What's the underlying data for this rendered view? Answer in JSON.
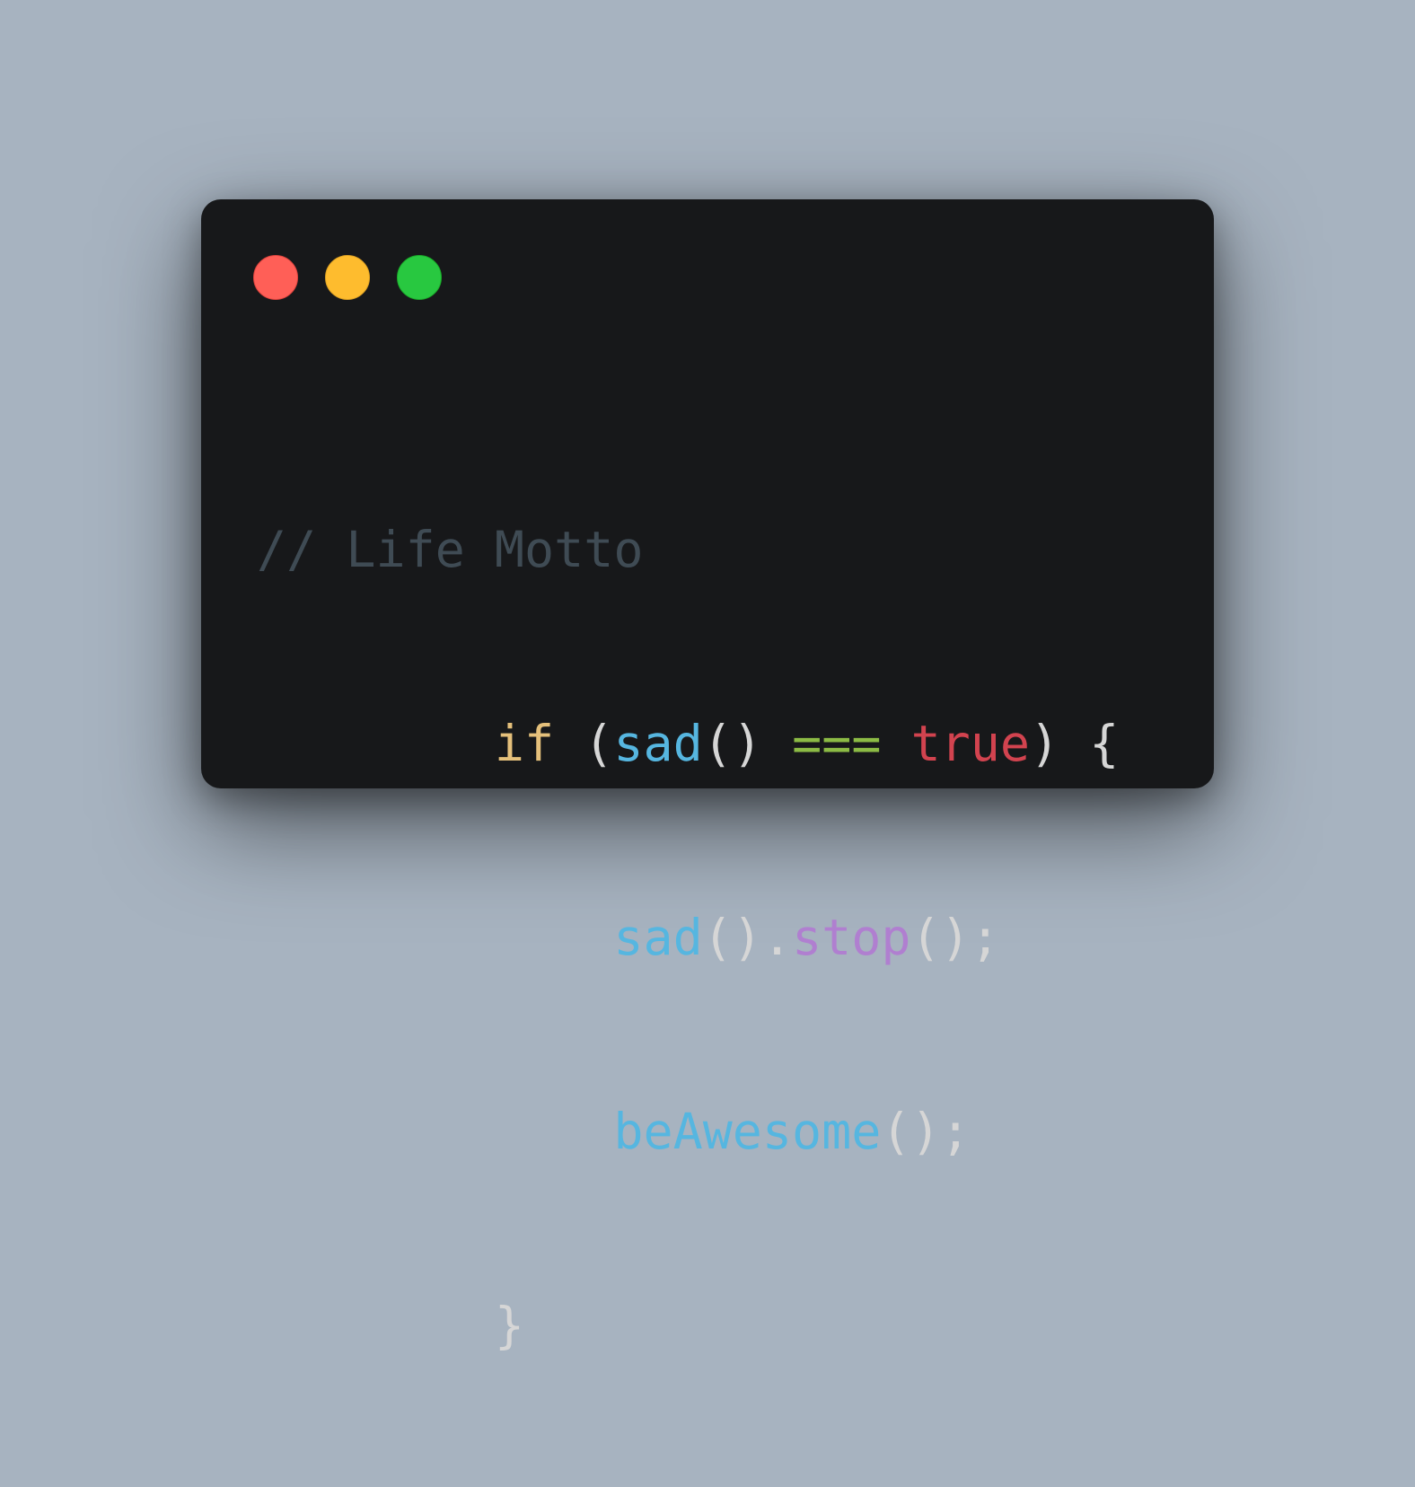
{
  "window_controls": {
    "close_color": "#ff5f57",
    "minimize_color": "#febc2e",
    "maximize_color": "#28c840"
  },
  "code": {
    "comment": "// Life Motto",
    "line1": {
      "indent": "        ",
      "keyword": "if",
      "space": " ",
      "open_paren": "(",
      "call": "sad",
      "call_parens": "()",
      "space2": " ",
      "operator": "===",
      "space3": " ",
      "value": "true",
      "close_paren": ")",
      "space4": " ",
      "open_brace": "{"
    },
    "line2": {
      "indent": "            ",
      "call": "sad",
      "call_parens": "()",
      "dot": ".",
      "method": "stop",
      "end": "();"
    },
    "line3": {
      "indent": "            ",
      "call": "beAwesome",
      "end": "();"
    },
    "line4": {
      "indent": "        ",
      "close_brace": "}"
    }
  },
  "colors": {
    "background": "#a7b3c0",
    "window": "#17181a",
    "comment": "#3f4b54",
    "keyword": "#e5c07b",
    "function": "#56b6e0",
    "operator": "#8cbb45",
    "boolean": "#d2434f",
    "method": "#b07fd0",
    "punctuation": "#d6d6d6"
  }
}
